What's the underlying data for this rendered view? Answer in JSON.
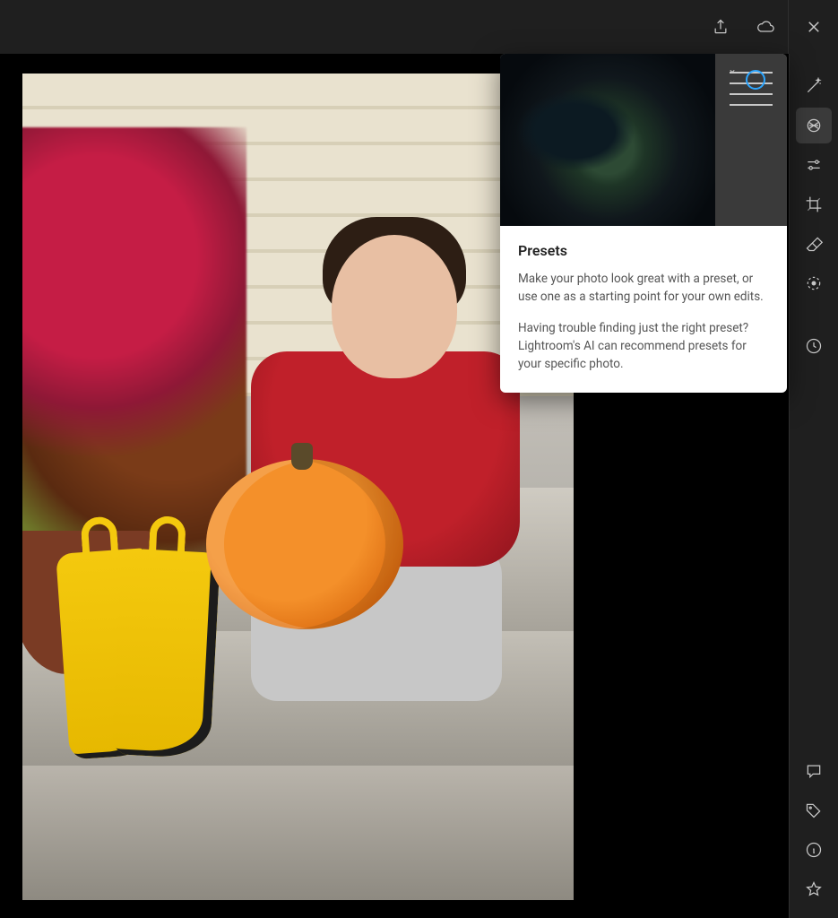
{
  "topbar": {
    "share_icon": "share-icon",
    "cloud_icon": "cloud-icon",
    "close_icon": "close-icon"
  },
  "tools": {
    "auto": "auto-icon",
    "presets": "presets-icon",
    "edit": "sliders-icon",
    "crop": "crop-icon",
    "heal": "eraser-icon",
    "mask": "mask-icon",
    "versions": "history-icon"
  },
  "bottom_tools": {
    "comment": "comment-icon",
    "tag": "tag-icon",
    "info": "info-icon",
    "star": "star-icon"
  },
  "popover": {
    "title": "Presets",
    "p1": "Make your photo look great with a preset, or use one as a starting point for your own edits.",
    "p2": "Having trouble finding just the right preset? Lightroom's AI can recommend presets for your specific photo."
  }
}
